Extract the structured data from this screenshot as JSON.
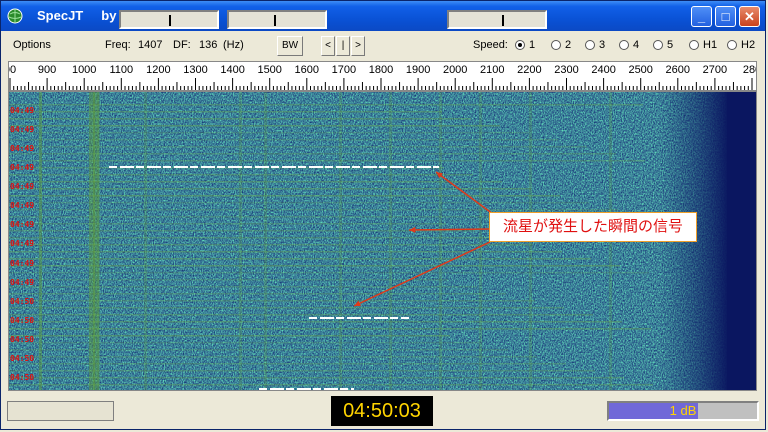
{
  "window": {
    "title": "SpecJT     by K1JT",
    "controls": {
      "minimize": "_",
      "maximize": "□",
      "close": "✕"
    }
  },
  "toolbar": {
    "options_label": "Options",
    "freq_label": "Freq:",
    "freq_value": "1407",
    "df_label": "DF:",
    "df_value": "136",
    "df_unit": "(Hz)",
    "bw_button": "BW",
    "nav": [
      "<",
      "|",
      ">"
    ],
    "speed_label": "Speed:",
    "speed_options": [
      {
        "label": "1",
        "selected": true
      },
      {
        "label": "2",
        "selected": false
      },
      {
        "label": "3",
        "selected": false
      },
      {
        "label": "4",
        "selected": false
      },
      {
        "label": "5",
        "selected": false
      },
      {
        "label": "H1",
        "selected": false
      },
      {
        "label": "H2",
        "selected": false
      }
    ]
  },
  "ruler": {
    "labels": [
      "00",
      "900",
      "1000",
      "1100",
      "1200",
      "1300",
      "1400",
      "1500",
      "1600",
      "1700",
      "1800",
      "1900",
      "2000",
      "2100",
      "2200",
      "2300",
      "2400",
      "2500",
      "2600",
      "2700",
      "280"
    ]
  },
  "spectrum": {
    "time_labels": [
      "04:49",
      "04:49",
      "04:49",
      "04:49",
      "04:49",
      "04:49",
      "04:49",
      "04:49",
      "04:49",
      "04:49",
      "04:50",
      "04:50",
      "04:50",
      "04:50",
      "04:50"
    ],
    "annotation": "流星が発生した瞬間の信号",
    "colors": {
      "background": "#12306e",
      "signal": "#8fc63a",
      "ping": "#ffffff",
      "right_band": "#0a1660",
      "label": "#e01010",
      "arrow": "#e03a1a"
    }
  },
  "status": {
    "clock": "04:50:03",
    "db_label": "1 dB",
    "db_fill_fraction": 0.6,
    "slider_positions": [
      0.5,
      0.47,
      0.55
    ]
  }
}
